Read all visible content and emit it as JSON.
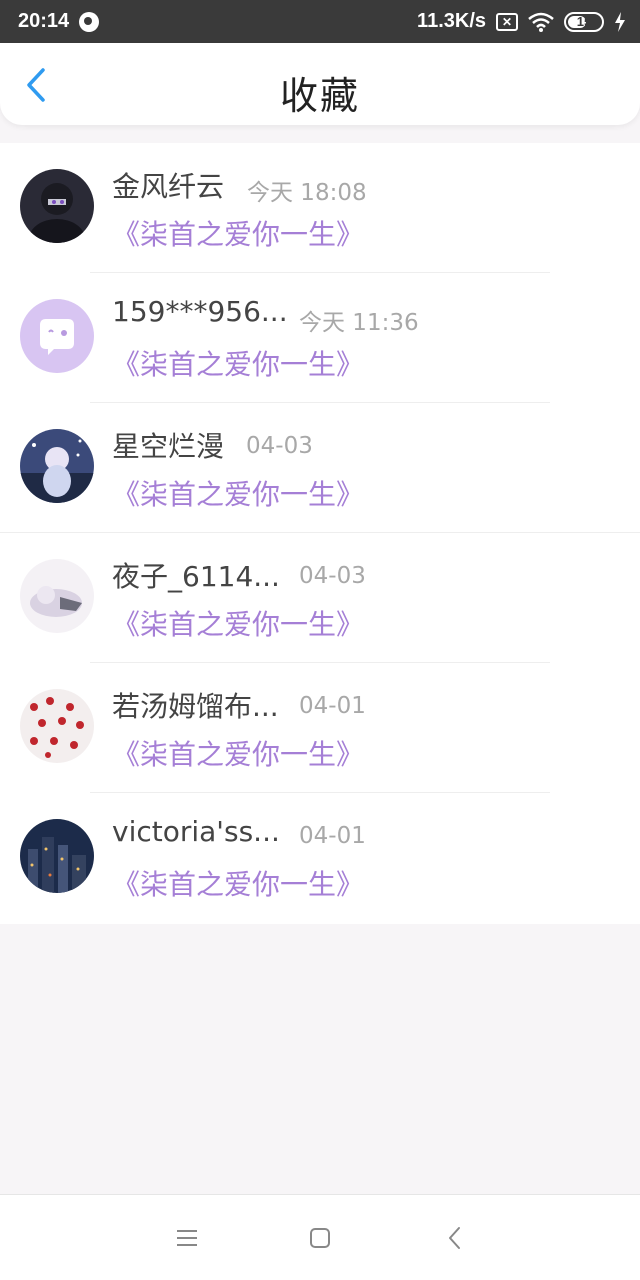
{
  "status_bar": {
    "time": "20:14",
    "network_speed": "11.3K/s",
    "sim_label": "✕",
    "battery": "15",
    "icons": [
      "q-app-icon",
      "sim-icon",
      "wifi-icon",
      "battery-icon",
      "charging-icon"
    ]
  },
  "header": {
    "title": "收藏",
    "back_icon": "chevron-left-icon",
    "accent_color": "#2f9bf0"
  },
  "list": {
    "title_color": "#a57fd6",
    "items": [
      {
        "name": "金风纤云",
        "time": "今天 18:08",
        "title": "《柒首之爱你一生》"
      },
      {
        "name": "159***956...",
        "time": "今天 11:36",
        "title": "《柒首之爱你一生》"
      },
      {
        "name": "星空烂漫",
        "time": "04-03",
        "title": "《柒首之爱你一生》"
      },
      {
        "name": "夜子_6114...",
        "time": "04-03",
        "title": "《柒首之爱你一生》"
      },
      {
        "name": "若汤姆馏布...",
        "time": "04-01",
        "title": "《柒首之爱你一生》"
      },
      {
        "name": "victoria'ss...",
        "time": "04-01",
        "title": "《柒首之爱你一生》"
      }
    ]
  },
  "nav_bar": {
    "icons": [
      "menu-icon",
      "home-square-icon",
      "back-triangle-icon"
    ]
  }
}
